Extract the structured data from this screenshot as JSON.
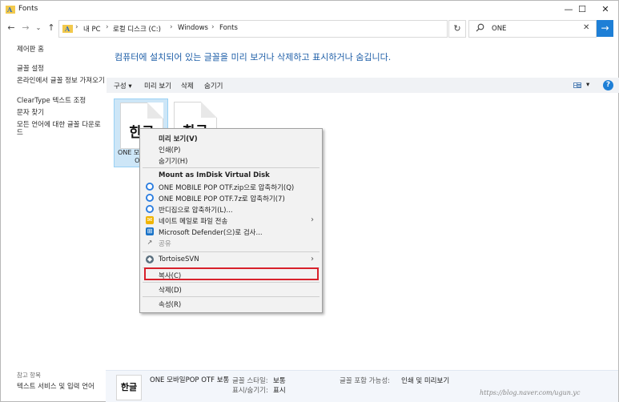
{
  "window": {
    "title": "Fonts",
    "min": "—",
    "max": "☐",
    "close": "✕"
  },
  "nav": {
    "back": "←",
    "forward": "→",
    "recent": "⌄",
    "up": "↑"
  },
  "address": {
    "crumbs": [
      "내 PC",
      "로컬 디스크 (C:)",
      "Windows",
      "Fonts"
    ],
    "sep": "›",
    "dropdown": "⌄",
    "refresh": "↻"
  },
  "search": {
    "value": "ONE",
    "clear": "✕",
    "go": "→"
  },
  "sidebar": {
    "items": [
      "제어판 홈",
      "글꼴 설정",
      "온라인에서 글꼴 정보 가져오기",
      "ClearType 텍스트 조정",
      "문자 찾기",
      "모든 언어에 대한 글꼴 다운로드"
    ],
    "see_also": "참고 항목",
    "see_also_items": [
      "텍스트 서비스 및 입력 언어"
    ]
  },
  "heading": "컴퓨터에 설치되어 있는 글꼴을 미리 보거나 삭제하고 표시하거나 숨깁니다.",
  "toolbar": {
    "organize": "구성 ▾",
    "preview": "미리 보기",
    "delete": "삭제",
    "hide": "숨기기",
    "view_dd": "▾",
    "help": "?"
  },
  "tiles": [
    {
      "glyph": "한글",
      "label": "ONE 모바일POP OTF"
    },
    {
      "glyph": "한글",
      "label": ""
    }
  ],
  "context_menu": {
    "items": [
      {
        "label": "미리 보기(V)",
        "bold": true
      },
      {
        "label": "인쇄(P)"
      },
      {
        "label": "숨기기(H)"
      },
      {
        "label": "Mount as ImDisk Virtual Disk",
        "bold": true
      },
      {
        "label": "ONE MOBILE POP OTF.zip으로 압축하기(Q)",
        "icon": "bandizip-icon"
      },
      {
        "label": "ONE MOBILE POP OTF.7z로 압축하기(7)",
        "icon": "bandizip-icon"
      },
      {
        "label": "반디집으로 압축하기(L)...",
        "icon": "bandizip-icon"
      },
      {
        "label": "네이트 메일로 파일 전송",
        "icon": "nate-icon"
      },
      {
        "label": "Microsoft Defender(으)로 검사...",
        "icon": "defender-icon"
      },
      {
        "label": "공유",
        "icon": "share-icon",
        "disabled": true
      },
      {
        "label": "TortoiseSVN",
        "icon": "tortoise-icon"
      },
      {
        "label": "복사(C)"
      },
      {
        "label": "삭제(D)"
      },
      {
        "label": "속성(R)"
      }
    ],
    "submenu_arrow": "›"
  },
  "details": {
    "thumb": "한글",
    "name": "ONE 모바일POP OTF 보통",
    "style_key": "글꼴 스타일:",
    "style_val": "보통",
    "show_key": "표시/숨기기:",
    "show_val": "표시",
    "embed_key": "글꼴 포함 가능성:",
    "embed_val": "인쇄 및 미리보기"
  },
  "watermark": "https://blog.naver.com/ugun.yc",
  "colors": {
    "accent": "#1e7fd6",
    "heading": "#1f5fa8",
    "highlight": "#d8212b",
    "selection": "#cde6f7"
  }
}
